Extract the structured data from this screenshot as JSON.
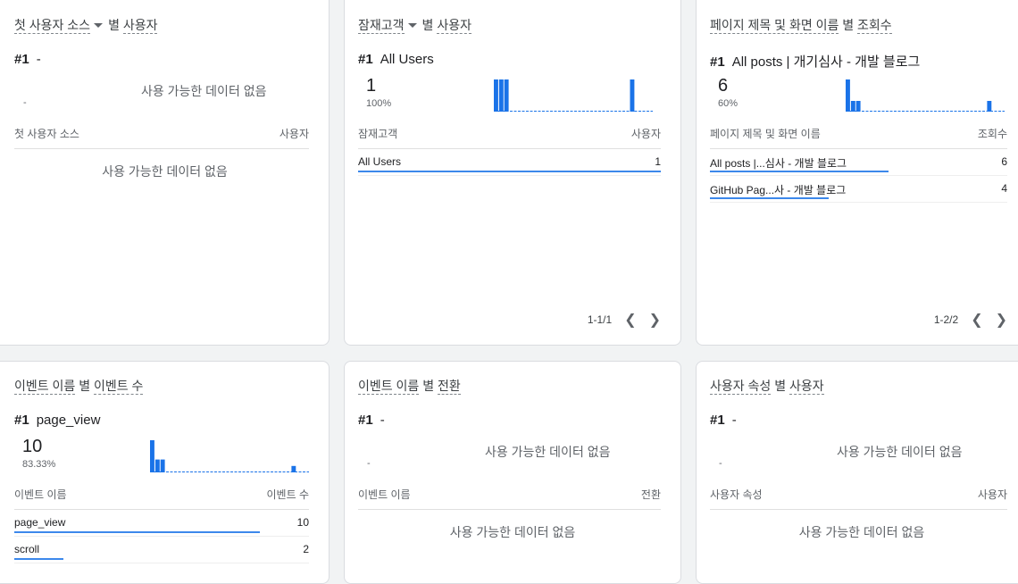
{
  "cards": [
    {
      "title_dim": "첫 사용자 소스",
      "title_by": "별",
      "title_metric": "사용자",
      "has_dropdown": true,
      "rank": "#1",
      "top_name": "-",
      "top_value": "-",
      "no_data": "사용 가능한 데이터 없음",
      "col_dim": "첫 사용자 소스",
      "col_metric": "사용자",
      "table_no_data": "사용 가능한 데이터 없음"
    },
    {
      "title_dim": "잠재고객",
      "title_by": "별",
      "title_metric": "사용자",
      "has_dropdown": true,
      "rank": "#1",
      "top_name": "All Users",
      "top_value": "1",
      "top_pct": "100%",
      "sparkline": [
        1,
        1,
        1,
        0,
        0,
        0,
        0,
        0,
        0,
        0,
        0,
        0,
        0,
        0,
        0,
        0,
        0,
        0,
        0,
        0,
        0,
        0,
        0,
        0,
        0,
        0,
        1,
        0,
        0,
        0
      ],
      "col_dim": "잠재고객",
      "col_metric": "사용자",
      "rows": [
        {
          "name": "All Users",
          "value": "1",
          "share": 1
        }
      ],
      "pagination": "1-1/1"
    },
    {
      "title_dim": "페이지 제목 및 화면 이름",
      "title_by": "별",
      "title_metric": "조회수",
      "rank": "#1",
      "top_name": "All posts | 개기심사 - 개발 블로그",
      "top_value": "6",
      "top_pct": "60%",
      "sparkline": [
        3,
        1,
        1,
        0,
        0,
        0,
        0,
        0,
        0,
        0,
        0,
        0,
        0,
        0,
        0,
        0,
        0,
        0,
        0,
        0,
        0,
        0,
        0,
        0,
        0,
        0,
        0,
        1,
        0,
        0
      ],
      "col_dim": "페이지 제목 및 화면 이름",
      "col_metric": "조회수",
      "rows": [
        {
          "name": "All posts |...심사 - 개발 블로그",
          "value": "6",
          "share": 0.6
        },
        {
          "name": "GitHub Pag...사 - 개발 블로그",
          "value": "4",
          "share": 0.4
        }
      ],
      "pagination": "1-2/2"
    },
    {
      "title_dim": "이벤트 이름",
      "title_by": "별",
      "title_metric": "이벤트 수",
      "rank": "#1",
      "top_name": "page_view",
      "top_value": "10",
      "top_pct": "83.33%",
      "sparkline": [
        5,
        2,
        2,
        0,
        0,
        0,
        0,
        0,
        0,
        0,
        0,
        0,
        0,
        0,
        0,
        0,
        0,
        0,
        0,
        0,
        0,
        0,
        0,
        0,
        0,
        0,
        0,
        1,
        0,
        0
      ],
      "col_dim": "이벤트 이름",
      "col_metric": "이벤트 수",
      "rows": [
        {
          "name": "page_view",
          "value": "10",
          "share": 0.833
        },
        {
          "name": "scroll",
          "value": "2",
          "share": 0.167
        }
      ]
    },
    {
      "title_dim": "이벤트 이름",
      "title_by": "별",
      "title_metric": "전환",
      "rank": "#1",
      "top_name": "-",
      "top_value": "-",
      "no_data": "사용 가능한 데이터 없음",
      "col_dim": "이벤트 이름",
      "col_metric": "전환",
      "table_no_data": "사용 가능한 데이터 없음"
    },
    {
      "title_dim": "사용자 속성",
      "title_by": "별",
      "title_metric": "사용자",
      "rank": "#1",
      "top_name": "-",
      "top_value": "-",
      "no_data": "사용 가능한 데이터 없음",
      "col_dim": "사용자 속성",
      "col_metric": "사용자",
      "table_no_data": "사용 가능한 데이터 없음"
    }
  ],
  "colors": {
    "accent": "#1a73e8"
  }
}
